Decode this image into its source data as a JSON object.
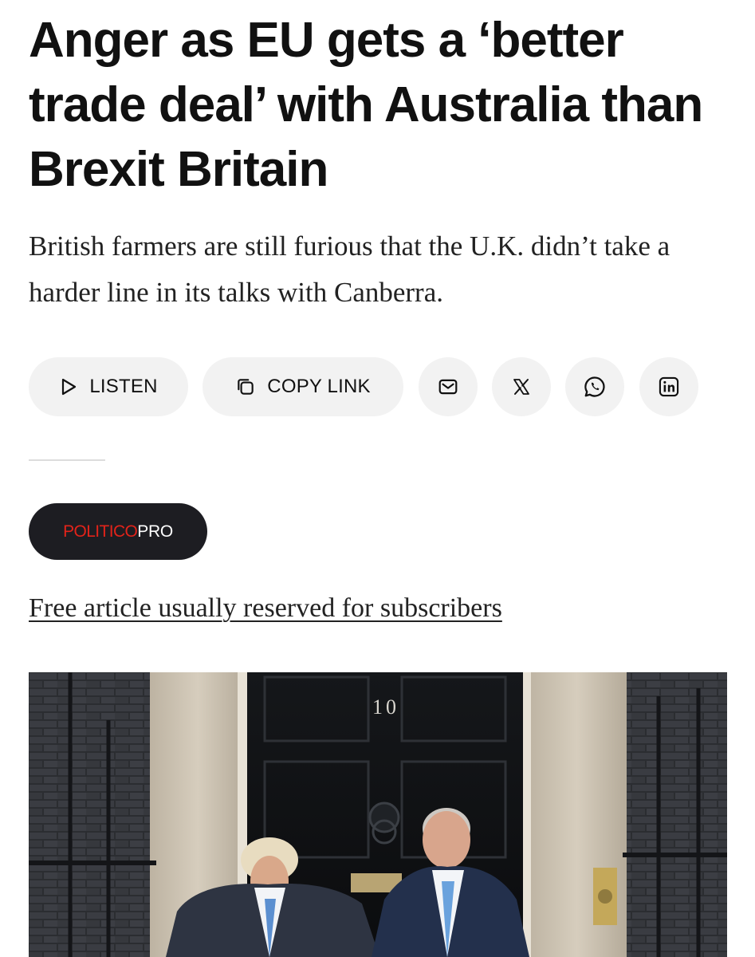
{
  "article": {
    "headline": "Anger as EU gets a ‘better trade deal’ with Australia than Brexit Britain",
    "dek": "British farmers are still furious that the U.K. didn’t take a harder line in its talks with Canberra."
  },
  "share": {
    "listen_label": "LISTEN",
    "copy_link_label": "COPY LINK",
    "icons": [
      "play-icon",
      "copy-icon",
      "mail-icon",
      "x-icon",
      "whatsapp-icon",
      "linkedin-icon"
    ]
  },
  "brand": {
    "main": "POLITICO",
    "sub": "PRO",
    "main_color": "#e2231a"
  },
  "access_note": "Free article usually reserved for subscribers",
  "photo": {
    "door_number": "10"
  },
  "colors": {
    "text": "#111111",
    "pill_bg": "#f2f2f2",
    "brand_bg": "#1d1d22"
  }
}
